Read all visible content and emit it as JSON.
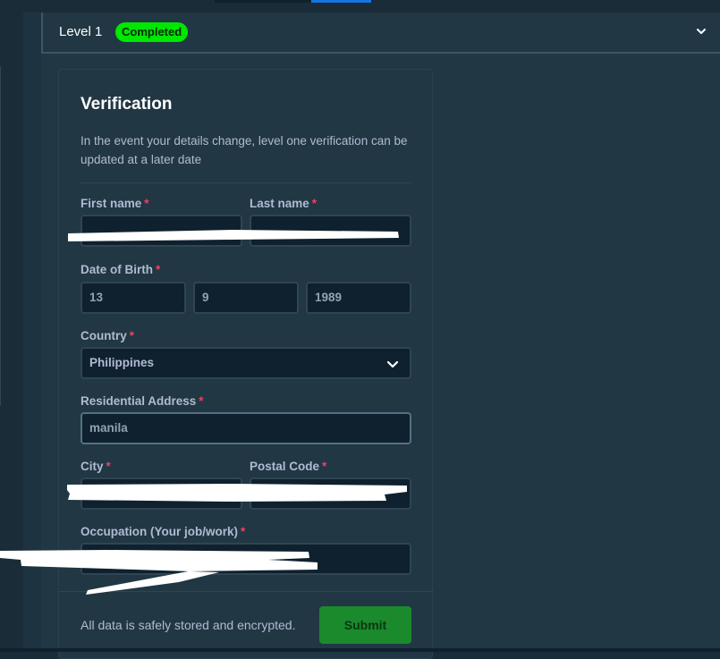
{
  "level": {
    "title": "Level 1",
    "badge": "Completed"
  },
  "verification": {
    "title": "Verification",
    "description": "In the event your details change, level one verification can be updated at a later date",
    "required_marker": "*",
    "fields": {
      "first_name": {
        "label": "First name",
        "value": ""
      },
      "last_name": {
        "label": "Last name",
        "value": ""
      },
      "dob": {
        "label": "Date of Birth",
        "day": "13",
        "month": "9",
        "year": "1989"
      },
      "country": {
        "label": "Country",
        "value": "Philippines"
      },
      "address": {
        "label": "Residential Address",
        "value": "manila"
      },
      "city": {
        "label": "City",
        "value": ""
      },
      "postal_code": {
        "label": "Postal Code",
        "value": ""
      },
      "occupation": {
        "label": "Occupation (Your job/work)",
        "value": ""
      }
    },
    "footer_note": "All data is safely stored and encrypted.",
    "submit_label": "Submit"
  },
  "colors": {
    "badge": "#00e701",
    "submit": "#1a8a2c",
    "required": "#ed4163"
  },
  "icons": [
    "chevron-down-icon"
  ]
}
